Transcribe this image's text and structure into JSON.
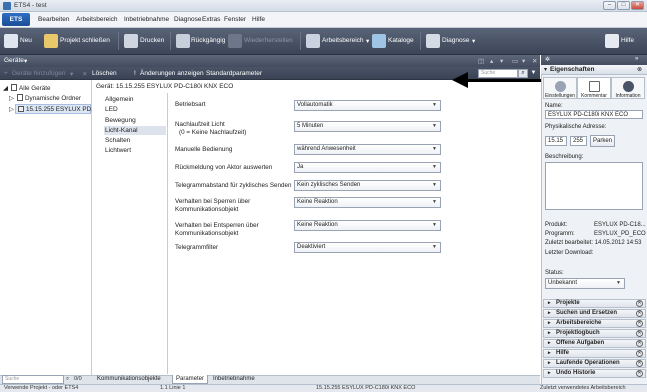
{
  "window": {
    "title": "ETS4 - test",
    "min": "–",
    "max": "□",
    "close": "✕"
  },
  "menu": {
    "ets": "ETS",
    "items": [
      "Bearbeiten",
      "Arbeitsbereich",
      "Inbetriebnahme",
      "Diagnose",
      "Extras",
      "Fenster",
      "Hilfe"
    ]
  },
  "toolbar": {
    "neu": "Neu",
    "projekt_schliessen": "Projekt schließen",
    "drucken": "Drucken",
    "rueckgaengig": "Rückgängig",
    "wiederherstellen": "Wiederherstellen",
    "arbeitsbereich": "Arbeitsbereich",
    "kataloge": "Kataloge",
    "diagnose": "Diagnose",
    "hilfe": "Hilfe"
  },
  "pane": {
    "title": "Geräte",
    "hinzufuegen": "Geräte hinzufügen",
    "loeschen": "Löschen",
    "aenderungen": "Änderungen anzeigen",
    "standardparameter": "Standardparameter",
    "search_placeholder": "Suche"
  },
  "tree": {
    "items": [
      "Alle Geräte",
      "Dynamische Ordner",
      "15.15.255  ESYLUX PD..."
    ]
  },
  "device": {
    "header": "Gerät: 15.15.255  ESYLUX PD-C180i KNX ECO",
    "categories": [
      "Allgemein",
      "LED",
      "Bewegung",
      "Licht-Kanal",
      "Schalten",
      "Lichtwert"
    ],
    "params": [
      {
        "label1": "Betriebsart",
        "label2": "",
        "value": "Vollautomatik"
      },
      {
        "label1": "Nachlaufzeit Licht",
        "label2": "(0 = Keine Nachlaufzeit)",
        "value": "5 Minuten"
      },
      {
        "label1": "Manuelle Bedienung",
        "label2": "",
        "value": "während Anwesenheit"
      },
      {
        "label1": "Rückmeldung von Aktor auswerten",
        "label2": "",
        "value": "Ja"
      },
      {
        "label1": "Telegrammabstand für zyklisches Senden",
        "label2": "",
        "value": "Kein zyklisches Senden"
      },
      {
        "label1": "Verhalten bei Sperren über",
        "label2": "Kommunikationsobjekt",
        "value": "Keine Reaktion"
      },
      {
        "label1": "Verhalten bei Entsperren über",
        "label2": "Kommunikationsobjekt",
        "value": "Keine Reaktion"
      },
      {
        "label1": "Telegrammfilter",
        "label2": "",
        "value": "Deaktiviert"
      }
    ]
  },
  "bottomtabs": {
    "search_placeholder": "Suche",
    "count": "0/0",
    "tabs": [
      "Kommunikationsobjekte",
      "Parameter",
      "Inbetriebnahme"
    ]
  },
  "statusbar": {
    "item1": "Verwende Projekt - oder ETS4",
    "item2": "1.1 Linie 1",
    "item3": "15.15.255  ESYLUX PD-C180i KNX ECO",
    "item4": "Zuletzt verwendetes Arbeitsbereich"
  },
  "properties": {
    "title": "Eigenschaften",
    "tabs": [
      "Einstellungen",
      "Kommentar",
      "Information"
    ],
    "name_label": "Name:",
    "name_value": "ESYLUX PD-C180i KNX ECO",
    "addr_label": "Physikalische Adresse:",
    "addr1": "15.15",
    "addr2": "255",
    "parken": "Parken",
    "beschreibung_label": "Beschreibung:",
    "produkt_label": "Produkt:",
    "produkt_value": "ESYLUX PD-C18...",
    "programm_label": "Programm:",
    "programm_value": "ESYLUX_PD_ECO",
    "zuletzt": "Zuletzt bearbeitet: 14.05.2012 14:53",
    "download": "Letzter Download:",
    "status_label": "Status:",
    "status_value": "Unbekannt"
  },
  "sections": [
    "Projekte",
    "Suchen und Ersetzen",
    "Arbeitsbereiche",
    "Projektlogbuch",
    "Offene Aufgaben",
    "Hilfe",
    "Laufende Operationen",
    "Undo Historie"
  ]
}
